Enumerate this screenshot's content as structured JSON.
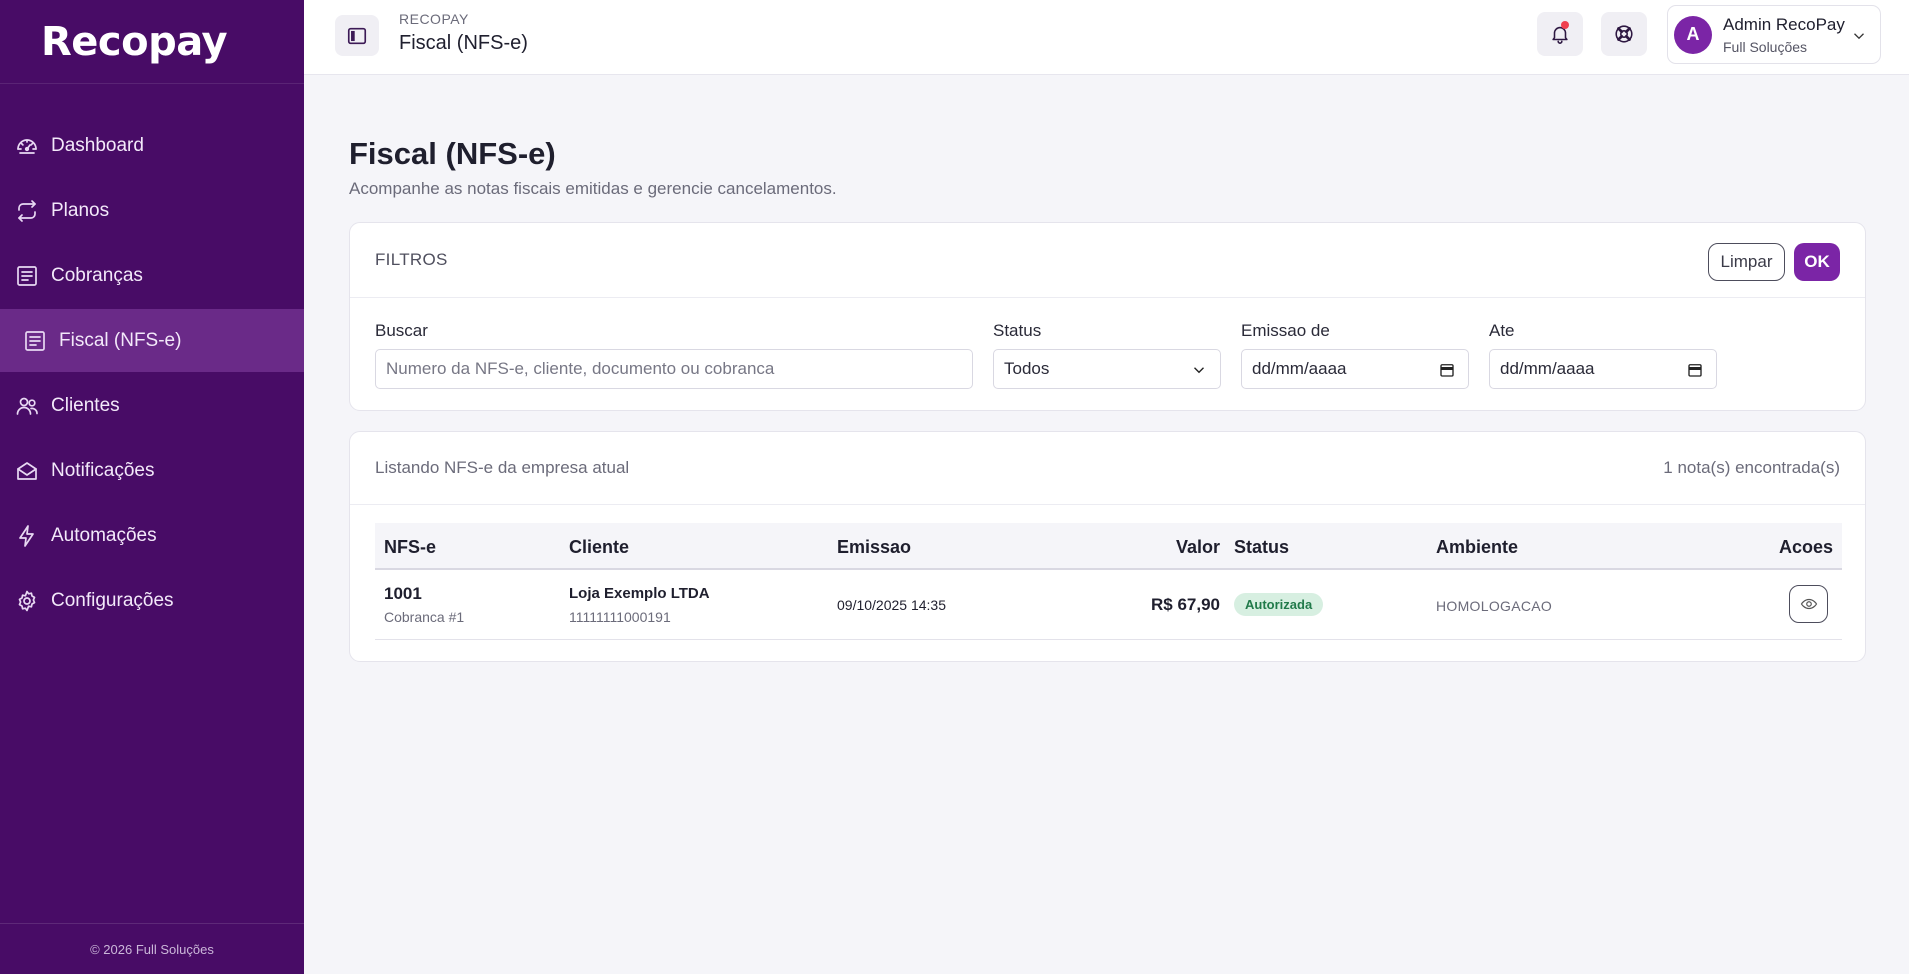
{
  "brand": {
    "logo": "Recopay"
  },
  "sidebar": {
    "items": [
      {
        "label": "Dashboard",
        "icon": "gauge-icon"
      },
      {
        "label": "Planos",
        "icon": "repeat-icon"
      },
      {
        "label": "Cobranças",
        "icon": "receipt-icon"
      },
      {
        "label": "Fiscal (NFS-e)",
        "icon": "receipt-icon",
        "active": true
      },
      {
        "label": "Clientes",
        "icon": "users-icon"
      },
      {
        "label": "Notificações",
        "icon": "mail-icon"
      },
      {
        "label": "Automações",
        "icon": "bolt-icon"
      },
      {
        "label": "Configurações",
        "icon": "gear-icon"
      }
    ],
    "footer": "© 2026 Full Soluções"
  },
  "header": {
    "kicker": "RECOPAY",
    "title": "Fiscal (NFS-e)",
    "user": {
      "initial": "A",
      "name": "Admin RecoPay",
      "org": "Full Soluções"
    }
  },
  "page": {
    "title": "Fiscal (NFS-e)",
    "subtitle": "Acompanhe as notas fiscais emitidas e gerencie cancelamentos."
  },
  "filters": {
    "heading": "FILTROS",
    "clear_label": "Limpar",
    "ok_label": "OK",
    "search": {
      "label": "Buscar",
      "placeholder": "Numero da NFS-e, cliente, documento ou cobranca"
    },
    "status": {
      "label": "Status",
      "value": "Todos"
    },
    "emissao_de": {
      "label": "Emissao de",
      "placeholder": "dd/mm/aaaa"
    },
    "ate": {
      "label": "Ate",
      "placeholder": "dd/mm/aaaa"
    }
  },
  "list": {
    "caption": "Listando NFS-e da empresa atual",
    "count": "1 nota(s) encontrada(s)",
    "columns": {
      "nfse": "NFS-e",
      "cliente": "Cliente",
      "emissao": "Emissao",
      "valor": "Valor",
      "status": "Status",
      "ambiente": "Ambiente",
      "acoes": "Acoes"
    },
    "rows": [
      {
        "number": "1001",
        "reference": "Cobranca #1",
        "client_name": "Loja Exemplo LTDA",
        "client_doc": "11111111000191",
        "emissao": "09/10/2025 14:35",
        "valor": "R$ 67,90",
        "status": "Autorizada",
        "ambiente": "HOMOLOGACAO"
      }
    ]
  },
  "colors": {
    "sidebar": "#480c66",
    "accent": "#7b25a6",
    "success_bg": "#d7efe1",
    "success_text": "#217a4a"
  }
}
